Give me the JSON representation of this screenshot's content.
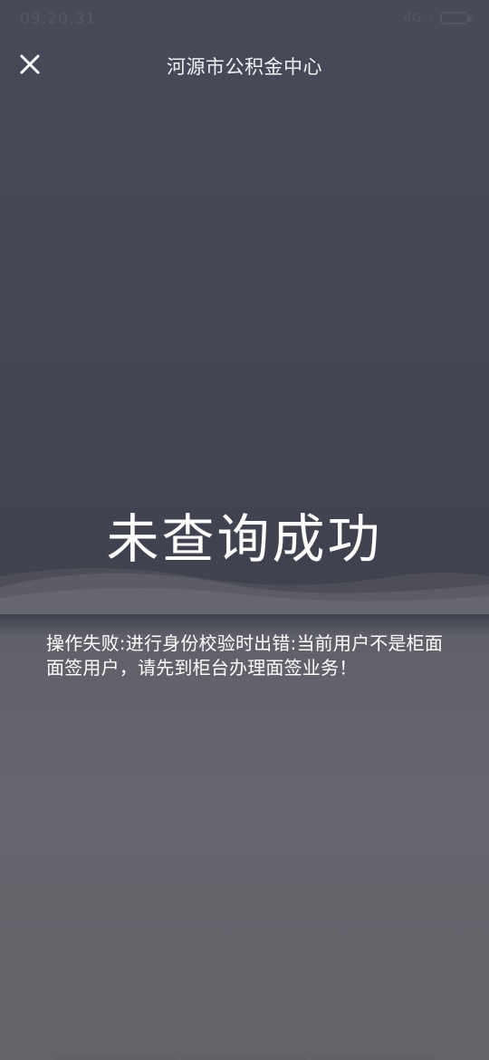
{
  "status_bar": {
    "time_text": "09:20:31",
    "signal_text": "4G",
    "battery_icon": "battery-icon",
    "bolt_icon": "bolt-icon"
  },
  "header": {
    "title": "河源市公积金中心",
    "close_icon": "close-icon"
  },
  "result": {
    "title": "未查询成功",
    "message": "操作失败:进行身份校验时出错:当前用户不是柜面面签用户，请先到柜台办理面签业务！"
  },
  "colors": {
    "background_top": "#474a58",
    "background_bottom": "#636368",
    "text": "#ffffff"
  }
}
